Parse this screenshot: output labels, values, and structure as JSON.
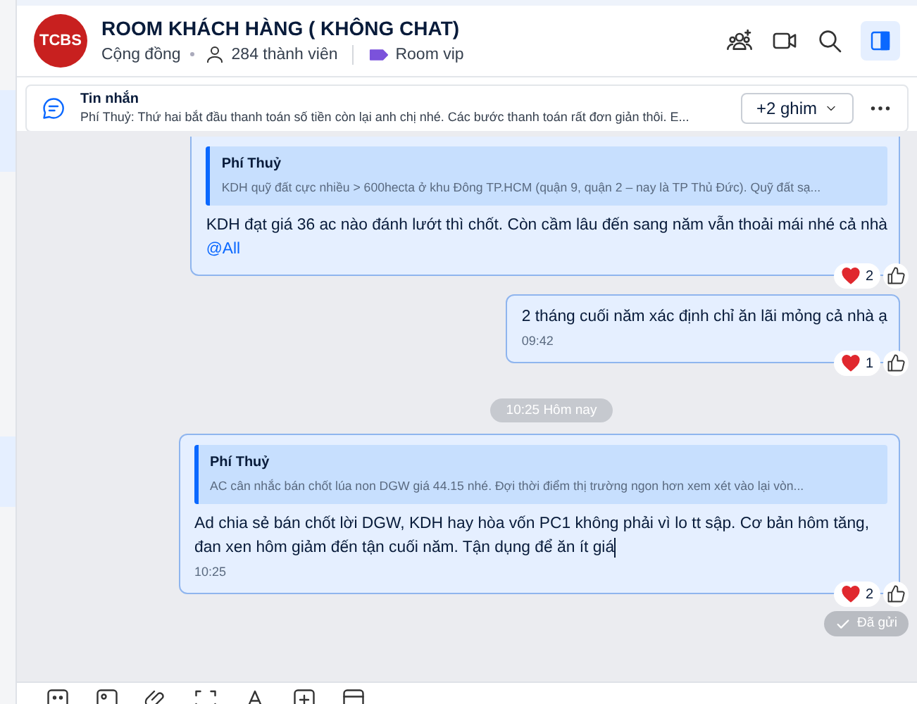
{
  "header": {
    "avatar_text": "TCBS",
    "title": "ROOM KHÁCH HÀNG ( KHÔNG CHAT)",
    "type": "Cộng đồng",
    "members": "284 thành viên",
    "label": "Room vip",
    "panel_open": true
  },
  "pinned": {
    "title": "Tin nhắn",
    "preview": "Phí Thuỷ: Thứ hai bắt đầu thanh toán số tiền còn lại anh chị nhé. Các bước thanh toán rất đơn giản thôi. E...",
    "pins_button": "+2 ghim"
  },
  "timeline": [
    {
      "kind": "message",
      "quote": {
        "author": "Phí Thuỷ",
        "text": "KDH quỹ đất cực nhiều > 600hecta ở khu Đông TP.HCM (quận 9, quận 2 – nay là TP Thủ Đức). Quỹ đất sạ..."
      },
      "text": "KDH đạt giá 36 ac nào đánh lướt thì chốt. Còn cầm lâu đến sang năm vẫn thoải mái nhé cả nhà",
      "mention": "@All",
      "reaction_count": "2"
    },
    {
      "kind": "message",
      "text": "2 tháng cuối năm xác định chỉ ăn lãi mỏng cả nhà ạ",
      "time": "09:42",
      "reaction_count": "1"
    },
    {
      "kind": "divider",
      "text": "10:25 Hôm nay"
    },
    {
      "kind": "message",
      "quote": {
        "author": "Phí Thuỷ",
        "text": "AC cân nhắc bán chốt lúa non DGW giá 44.15 nhé. Đợi thời điểm thị trường ngon hơn xem xét vào lại vòn..."
      },
      "text": "Ad chia sẻ bán chốt lời DGW, KDH hay hòa vốn PC1 không phải vì lo tt sập. Cơ bản hôm tăng, đan xen hôm giảm đến tận cuối năm. Tận dụng để ăn ít giá",
      "editing": true,
      "time": "10:25",
      "reaction_count": "2",
      "status": "Đã gửi"
    }
  ]
}
